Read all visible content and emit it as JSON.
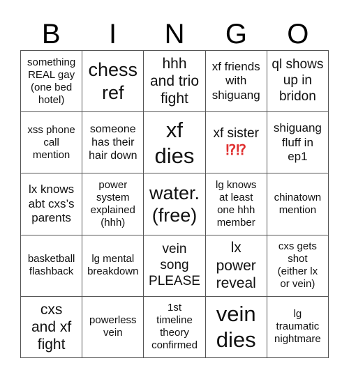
{
  "header": {
    "letters": [
      "B",
      "I",
      "N",
      "G",
      "O"
    ]
  },
  "cells": [
    [
      "something\nREAL gay\n(one bed\nhotel)",
      "chess\nref",
      "hhh\nand trio\nfight",
      "xf friends\nwith\nshiguang",
      "ql shows\nup in\nbridon"
    ],
    [
      "xss phone\ncall\nmention",
      "someone\nhas their\nhair down",
      "xf\ndies",
      "xf sister",
      "shiguang\nfluff in\nep1"
    ],
    [
      "lx knows\nabt cxs’s\nparents",
      "power\nsystem\nexplained\n(hhh)",
      "water.\n(free)",
      "lg knows\nat least\none hhh\nmember",
      "chinatown\nmention"
    ],
    [
      "basketball\nflashback",
      "lg mental\nbreakdown",
      "vein\nsong\nPLEASE",
      "lx\npower\nreveal",
      "cxs gets\nshot\n(either lx\nor vein)"
    ],
    [
      "cxs\nand xf\nfight",
      "powerless\nvein",
      "1st\ntimeline\ntheory\nconfirmed",
      "vein\ndies",
      "lg\ntraumatic\nnightmare"
    ]
  ],
  "extras": {
    "xf_sister_emoji": "⁉⁉"
  },
  "colors": {
    "accent_red": "#e03030",
    "grid_line": "#555555"
  }
}
